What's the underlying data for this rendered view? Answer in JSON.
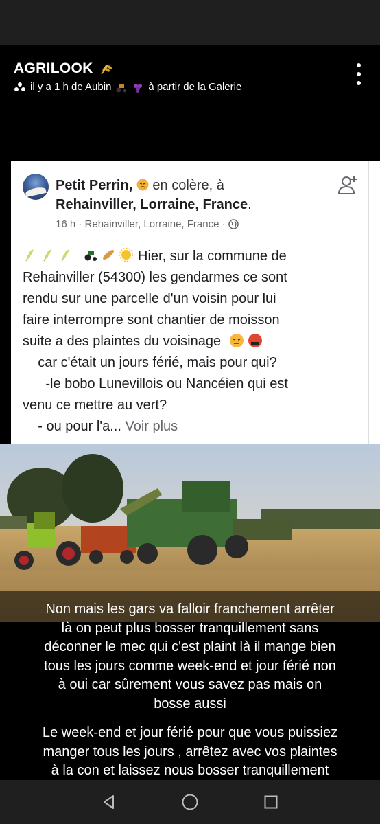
{
  "story": {
    "title": "AGRILOOK",
    "subtitle_prefix": "il y a 1 h de Aubin",
    "subtitle_suffix": "à partir de la Galerie"
  },
  "post": {
    "author": "Petit Perrin,",
    "feeling": "en colère, à",
    "place": "Rehainviller, Lorraine, France",
    "place_end": ".",
    "meta": "16 h · Rehainviller, Lorraine, France ·",
    "lines": [
      "Hier, sur la commune de",
      "Rehainviller (54300) les gendarmes ce sont",
      "rendu sur une parcelle d'un voisin pour lui",
      "faire interrompre sont chantier de moisson",
      "suite a des plaintes du voisinage",
      "    car c'était un jours férié, mais pour qui?",
      "      -le bobo Lunevillois ou Nancéien qui est",
      "venu ce mettre au vert?",
      "    - ou pour l'a..."
    ],
    "see_more": "Voir plus"
  },
  "caption_top": [
    "Non mais les gars va falloir franchement arrêter",
    "là on peut plus bosser tranquillement sans",
    "déconner le mec qui c'est plaint là il mange bien",
    "tous les jours comme week-end et jour férié non",
    "à oui car sûrement vous savez pas mais on",
    "bosse aussi"
  ],
  "caption_bottom": [
    "Le week-end et jour férié pour que vous puissiez",
    "manger tous les jours , arrêtez avec vos plaintes",
    "à la con et laissez nous bosser tranquillement"
  ],
  "colors": {
    "accent_green": "#4f7d2f",
    "facebook_grey": "#65676b"
  }
}
